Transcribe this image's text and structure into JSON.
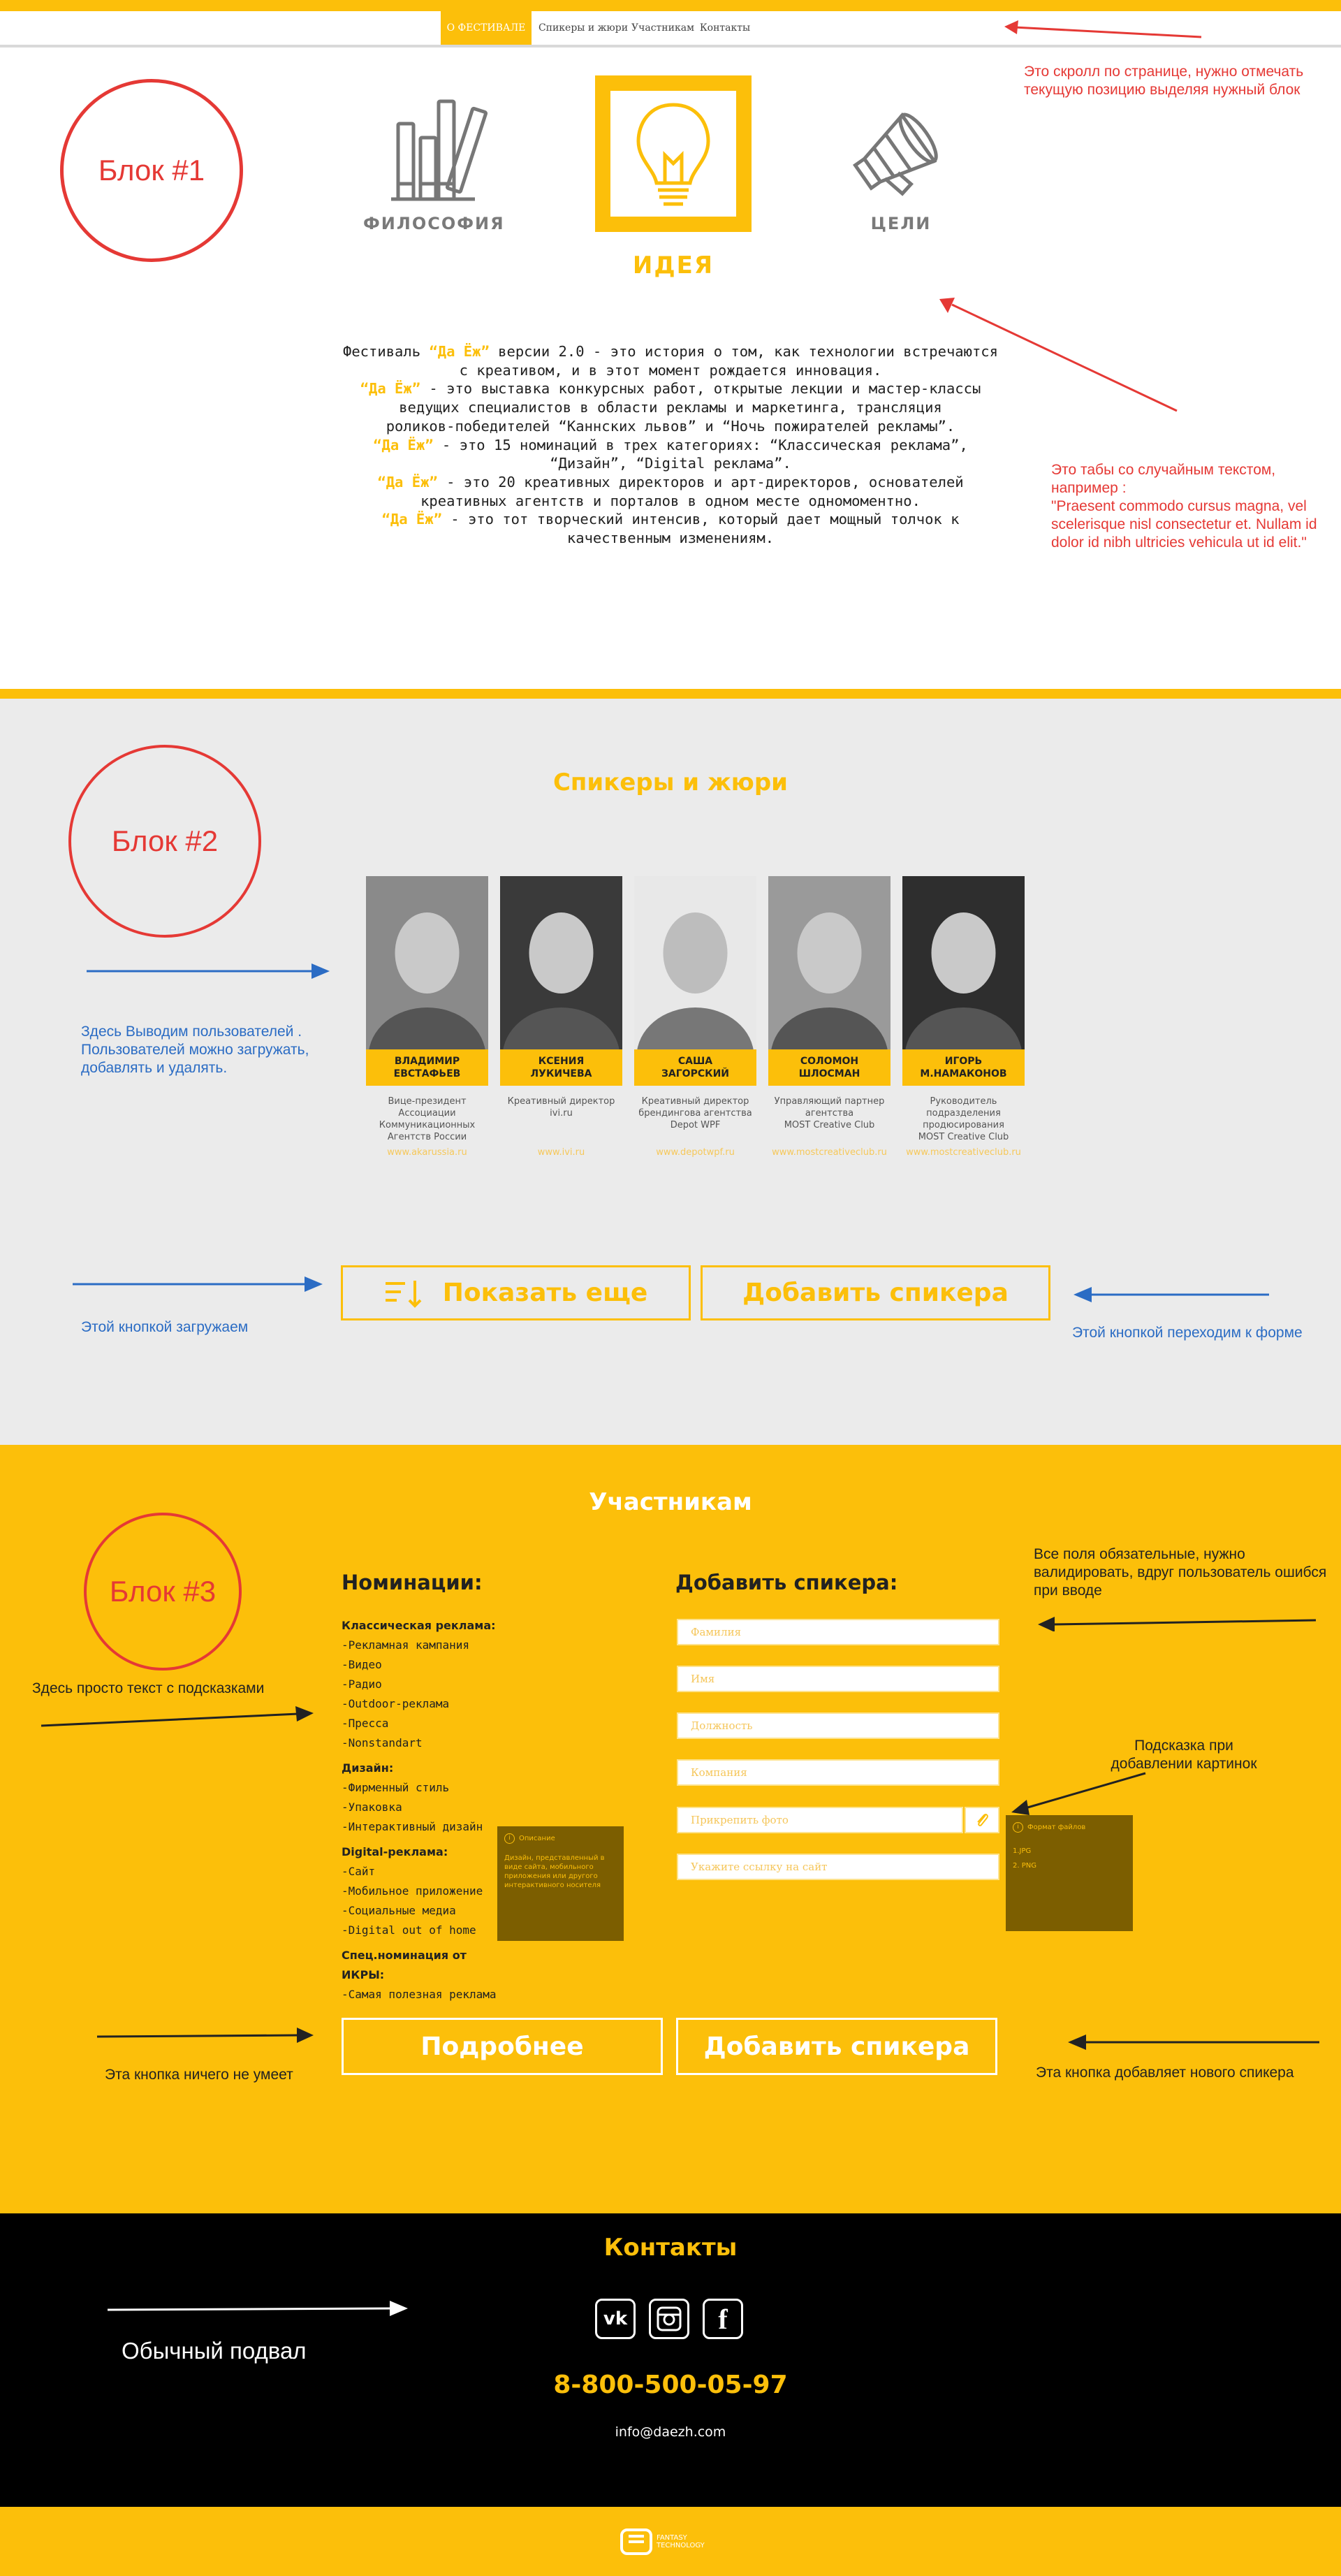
{
  "nav": {
    "items": [
      "О ФЕСТИВАЛЕ",
      "Спикеры и жюри",
      "Участникам",
      "Контакты"
    ],
    "active_index": 0
  },
  "annotations": {
    "scroll_note": "Это скролл по странице, нужно отмечать текущую позицию выделяя нужный блок",
    "block1": "Блок #1",
    "tabs_note_line1": "Это табы со случайным текстом, например :",
    "tabs_note_line2": "\"Praesent commodo cursus magna, vel scelerisque nisl consectetur et. Nullam id dolor id nibh ultricies vehicula ut id elit.\"",
    "block2": "Блок #2",
    "users_note": "Здесь Выводим пользователей . Пользователей можно загружать, добавлять и удалять.",
    "load_note": "Этой кнопкой загружаем",
    "form_note": "Этой кнопкой переходим к форме",
    "block3": "Блок #3",
    "hints_note": "Здесь просто текст с подсказками",
    "required_note": "Все поля обязательные, нужно валидировать, вдруг пользователь ошибся при вводе",
    "photo_hint_note": "Подсказка при добавлении картинок",
    "more_btn_note": "Эта кнопка ничего не умеет",
    "add_btn_note": "Эта кнопка добавляет нового спикера",
    "footer_note": "Обычный подвал"
  },
  "tabs": [
    {
      "label": "ФИЛОСОФИЯ",
      "icon": "books-icon"
    },
    {
      "label": "ИДЕЯ",
      "icon": "lightbulb-icon"
    },
    {
      "label": "ЦЕЛИ",
      "icon": "megaphone-icon"
    }
  ],
  "active_tab": 1,
  "festival": {
    "lines": [
      {
        "pre": "Фестиваль ",
        "hl": "“Да Ёж”",
        "post": " версии 2.0 - это история о том, как технологии встречаются"
      },
      {
        "pre": "с креативом, и в этот момент рождается инновация.",
        "hl": "",
        "post": ""
      },
      {
        "pre": "",
        "hl": "“Да Ёж”",
        "post": " - это выставка конкурсных работ, открытые лекции и мастер-классы"
      },
      {
        "pre": "ведущих специалистов в области рекламы и маркетинга, трансляция",
        "hl": "",
        "post": ""
      },
      {
        "pre": "роликов-победителей “Каннских львов” и “Ночь пожирателей рекламы”.",
        "hl": "",
        "post": ""
      },
      {
        "pre": "",
        "hl": "“Да Ёж”",
        "post": " - это 15 номинаций в трех категориях: “Классическая реклама”,"
      },
      {
        "pre": "“Дизайн”, “Digital реклама”.",
        "hl": "",
        "post": ""
      },
      {
        "pre": "",
        "hl": "“Да Ёж”",
        "post": " - это 20 креативных директоров и арт-директоров, основателей"
      },
      {
        "pre": "креативных агентств и порталов в одном месте одномоментно.",
        "hl": "",
        "post": ""
      },
      {
        "pre": "",
        "hl": "“Да Ёж”",
        "post": " - это тот творческий интенсив, который дает мощный толчок к"
      },
      {
        "pre": "качественным изменениям.",
        "hl": "",
        "post": ""
      }
    ]
  },
  "speakers": {
    "title": "Спикеры и жюри",
    "items": [
      {
        "name1": "ВЛАДИМИР",
        "name2": "ЕВСТАФЬЕВ",
        "role": [
          "Вице-президент",
          "Ассоциации",
          "Коммуникационных",
          "Агентств России"
        ],
        "url": "www.akarussia.ru"
      },
      {
        "name1": "КСЕНИЯ",
        "name2": "ЛУКИЧЕВА",
        "role": [
          "Креативный директор",
          "ivi.ru"
        ],
        "url": "www.ivi.ru"
      },
      {
        "name1": "САША",
        "name2": "ЗАГОРСКИЙ",
        "role": [
          "Креативный директор",
          "брендингова агентства",
          "Depot WPF"
        ],
        "url": "www.depotwpf.ru"
      },
      {
        "name1": "СОЛОМОН",
        "name2": "ШЛОСМАН",
        "role": [
          "Управляющий партнер",
          "агентства",
          "MOST Creative Club"
        ],
        "url": "www.mostcreativeclub.ru"
      },
      {
        "name1": "ИГОРЬ",
        "name2": "М.НАМАКОНОВ",
        "role": [
          "Руководитель",
          "подразделения",
          "продюсирования",
          "MOST Creative Club"
        ],
        "url": "www.mostcreativeclub.ru"
      }
    ],
    "show_more": "Показать еще",
    "add_speaker": "Добавить спикера"
  },
  "participants": {
    "title": "Участникам",
    "nominations_title": "Номинации:",
    "groups": [
      {
        "title": "Классическая реклама:",
        "items": [
          "-Рекламная кампания",
          "-Видео",
          "-Радио",
          "-Outdoor-реклама",
          "-Пресса",
          "-Nonstandart"
        ]
      },
      {
        "title": "Дизайн:",
        "items": [
          "-Фирменный стиль",
          "-Упаковка",
          "-Интерактивный дизайн"
        ]
      },
      {
        "title": "Digital-реклама:",
        "items": [
          "-Сайт",
          "-Мобильное приложение",
          "-Социальные медиа",
          "-Digital out of home"
        ]
      },
      {
        "title": "Спец.номинация от ИКРЫ:",
        "items": [
          "-Самая полезная реклама"
        ]
      }
    ],
    "tooltip_title": "Описание",
    "tooltip_text": "Дизайн, представленный в виде сайта, мобильного приложения или другого интерактивного носителя",
    "form_title": "Добавить спикера:",
    "fields": [
      "Фамилия",
      "Имя",
      "Должность",
      "Компания",
      "Прикрепить фото",
      "Укажите ссылку на сайт"
    ],
    "photo_tip_title": "Формат файлов",
    "photo_tip_lines": [
      "1.JPG",
      "2. PNG"
    ],
    "more_btn": "Подробнее",
    "add_btn": "Добавить спикера"
  },
  "footer": {
    "title": "Контакты",
    "socials": [
      {
        "icon": "vk-icon",
        "glyph": "vk"
      },
      {
        "icon": "instagram-icon",
        "glyph": ""
      },
      {
        "icon": "facebook-icon",
        "glyph": "f"
      }
    ],
    "phone": "8-800-500-05-97",
    "email": "info@daezh.com",
    "brand_line1": "FANTASY",
    "brand_line2": "TECHNOLOGY"
  },
  "colors": {
    "accent": "#fcbf0a",
    "annotation_red": "#e53935",
    "annotation_blue": "#2b6cc4",
    "grey_bg": "#ebebeb",
    "footer_bg": "#000000"
  }
}
